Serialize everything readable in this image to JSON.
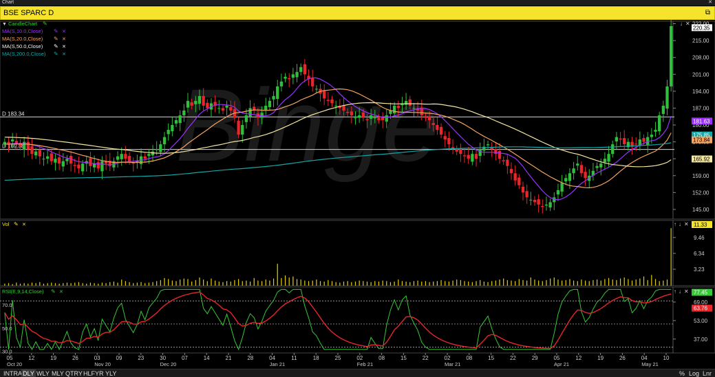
{
  "window": {
    "title": "Chart",
    "close_icon": "close-icon"
  },
  "symbol": {
    "name": "BSE SPARC D",
    "restore_icon": "restore-window-icon"
  },
  "colors": {
    "up": "#2fbf3a",
    "down": "#e8262b",
    "ma10": "#9b30ff",
    "ma20": "#f4a460",
    "ma50": "#f5e6a0",
    "ma200": "#14a8a8",
    "rsi": "#35c935",
    "rsi_signal": "#e8262b",
    "volume": "#e6d100",
    "yellow_bar": "#f5e32c"
  },
  "panels": {
    "price": {
      "legend": [
        {
          "label": "CandleChart",
          "color": "#35c935"
        },
        {
          "label": "MA(S,10.0,Close)",
          "color": "#9b30ff"
        },
        {
          "label": "MA(S,20.0,Close)",
          "color": "#f4a460"
        },
        {
          "label": "MA(S,50.0,Close)",
          "color": "#f5f5f5"
        },
        {
          "label": "MA(S,200.0,Close)",
          "color": "#14a8a8"
        }
      ],
      "hlines": [
        {
          "label": "D 183.34",
          "value": 183.34
        },
        {
          "label": "D 169.88",
          "value": 169.88
        }
      ],
      "ticks": [
        "222.00",
        "215.00",
        "208.00",
        "201.00",
        "194.00",
        "187.00",
        "180.00",
        "173.00",
        "166.00",
        "159.00",
        "152.00",
        "145.00"
      ],
      "last_tags": [
        {
          "label": "220.35",
          "value": 220.35,
          "bg": "#f5f5f5",
          "fg": "#000"
        },
        {
          "label": "181.63",
          "value": 181.63,
          "bg": "#9b30ff",
          "fg": "#fff"
        },
        {
          "label": "175.85",
          "value": 175.85,
          "bg": "#14a8a8",
          "fg": "#fff"
        },
        {
          "label": "173.84",
          "value": 173.84,
          "bg": "#f4a460",
          "fg": "#000"
        },
        {
          "label": "165.92",
          "value": 165.92,
          "bg": "#f5e6a0",
          "fg": "#000"
        }
      ]
    },
    "volume": {
      "legend": "Vol",
      "ticks": [
        "9.46",
        "6.34",
        "3.23"
      ],
      "last_tag": "11.33"
    },
    "rsi": {
      "legend": "RSI(E,9,14,Close)",
      "ticks": [
        "69.00",
        "53.00",
        "37.00"
      ],
      "left_labels": [
        "70.0",
        "50.0",
        "30.0"
      ],
      "tags": [
        {
          "label": "77.45",
          "value": 77.45,
          "bg": "#35c935"
        },
        {
          "label": "63.76",
          "value": 63.76,
          "bg": "#e8262b"
        }
      ]
    }
  },
  "xaxis": {
    "labels": [
      {
        "day": "05",
        "month": "Oct 20"
      },
      {
        "day": "12",
        "month": ""
      },
      {
        "day": "19",
        "month": ""
      },
      {
        "day": "26",
        "month": ""
      },
      {
        "day": "03",
        "month": "Nov 20"
      },
      {
        "day": "09",
        "month": ""
      },
      {
        "day": "23",
        "month": ""
      },
      {
        "day": "30",
        "month": "Dec 20"
      },
      {
        "day": "07",
        "month": ""
      },
      {
        "day": "14",
        "month": ""
      },
      {
        "day": "21",
        "month": ""
      },
      {
        "day": "28",
        "month": ""
      },
      {
        "day": "04",
        "month": "Jan 21"
      },
      {
        "day": "11",
        "month": ""
      },
      {
        "day": "18",
        "month": ""
      },
      {
        "day": "25",
        "month": ""
      },
      {
        "day": "02",
        "month": "Feb 21"
      },
      {
        "day": "08",
        "month": ""
      },
      {
        "day": "15",
        "month": ""
      },
      {
        "day": "22",
        "month": ""
      },
      {
        "day": "02",
        "month": "Mar 21"
      },
      {
        "day": "08",
        "month": ""
      },
      {
        "day": "15",
        "month": ""
      },
      {
        "day": "22",
        "month": ""
      },
      {
        "day": "29",
        "month": ""
      },
      {
        "day": "05",
        "month": "Apr 21"
      },
      {
        "day": "12",
        "month": ""
      },
      {
        "day": "19",
        "month": ""
      },
      {
        "day": "26",
        "month": ""
      },
      {
        "day": "04",
        "month": "May 21"
      },
      {
        "day": "10",
        "month": ""
      }
    ]
  },
  "bottom_tabs": [
    "INTRA",
    "DLY",
    "WLY",
    "MLY",
    "QTRY",
    "HLFYR",
    "YLY"
  ],
  "active_tab": "DLY",
  "bottom_right": [
    "%",
    "Log",
    "Lnr"
  ],
  "chart_data": {
    "type": "candlestick",
    "title": "BSE SPARC D",
    "ylim": [
      141,
      223
    ],
    "volume_ylim": [
      0,
      12
    ],
    "rsi_ylim": [
      25,
      82
    ],
    "closes": [
      173,
      172,
      174,
      172,
      171,
      173,
      170,
      168,
      169,
      167,
      166,
      167,
      165,
      166,
      164,
      165,
      166,
      164,
      163,
      162,
      164,
      165,
      163,
      164,
      162,
      165,
      164,
      163,
      165,
      167,
      168,
      166,
      165,
      164,
      165,
      167,
      166,
      168,
      169,
      170,
      172,
      175,
      178,
      180,
      182,
      184,
      186,
      190,
      188,
      190,
      192,
      188,
      187,
      189,
      188,
      187,
      186,
      188,
      186,
      183,
      176,
      180,
      184,
      187,
      186,
      183,
      185,
      188,
      190,
      192,
      196,
      198,
      200,
      199,
      201,
      202,
      204,
      201,
      199,
      196,
      195,
      193,
      191,
      190,
      189,
      188,
      187,
      186,
      185,
      184,
      183,
      184,
      183,
      182,
      184,
      183,
      182,
      182,
      184,
      186,
      188,
      187,
      189,
      190,
      188,
      187,
      186,
      184,
      183,
      182,
      180,
      178,
      176,
      174,
      172,
      170,
      169,
      168,
      167,
      166,
      168,
      166,
      170,
      171,
      172,
      170,
      168,
      166,
      165,
      163,
      160,
      157,
      155,
      152,
      150,
      149,
      148,
      147,
      146,
      147,
      148,
      150,
      153,
      156,
      158,
      160,
      162,
      164,
      160,
      158,
      159,
      161,
      163,
      164,
      166,
      168,
      172,
      175,
      174,
      172,
      173,
      171,
      172,
      174,
      173,
      175,
      176,
      178,
      184,
      188,
      196,
      221
    ],
    "volume": [
      0.4,
      0.5,
      0.3,
      0.6,
      0.4,
      0.5,
      0.4,
      0.6,
      0.5,
      0.7,
      0.4,
      0.5,
      0.6,
      0.5,
      0.4,
      0.5,
      0.6,
      0.5,
      0.6,
      0.7,
      0.5,
      0.4,
      0.6,
      0.5,
      0.4,
      0.6,
      0.5,
      0.7,
      0.8,
      0.6,
      1.2,
      0.9,
      0.7,
      0.5,
      0.6,
      0.7,
      0.5,
      0.6,
      0.7,
      0.9,
      1.1,
      1.5,
      1.3,
      1.0,
      0.9,
      1.2,
      1.4,
      1.3,
      0.8,
      1.1,
      1.6,
      1.2,
      0.9,
      1.4,
      1.0,
      0.8,
      0.7,
      0.9,
      0.8,
      1.1,
      1.3,
      0.9,
      1.0,
      0.8,
      1.5,
      1.0,
      0.9,
      1.2,
      1.0,
      1.4,
      4.3,
      1.5,
      2.0,
      1.6,
      1.8,
      1.3,
      1.2,
      1.0,
      0.9,
      1.0,
      1.2,
      0.9,
      0.8,
      1.1,
      0.9,
      0.7,
      0.6,
      0.8,
      0.9,
      0.7,
      0.8,
      1.0,
      0.9,
      0.8,
      0.7,
      0.9,
      0.8,
      1.0,
      0.9,
      0.7,
      0.8,
      1.2,
      0.9,
      0.8,
      0.7,
      0.9,
      1.0,
      0.8,
      0.9,
      0.7,
      0.8,
      0.9,
      1.1,
      0.9,
      0.8,
      1.0,
      1.2,
      1.1,
      0.9,
      0.8,
      0.7,
      0.9,
      1.1,
      0.8,
      0.7,
      0.9,
      1.0,
      1.2,
      1.4,
      1.1,
      1.0,
      0.9,
      1.3,
      1.1,
      1.0,
      1.6,
      1.2,
      1.0,
      0.9,
      1.1,
      1.4,
      1.6,
      1.2,
      1.0,
      1.1,
      1.3,
      1.0,
      0.9,
      1.2,
      1.0,
      0.9,
      1.1,
      1.2,
      1.0,
      1.3,
      1.5,
      1.2,
      1.1,
      1.4,
      1.6,
      1.3,
      1.0,
      1.2,
      1.4,
      1.8,
      1.1,
      2.1,
      1.3,
      0.9,
      1.0,
      1.2,
      11.3
    ]
  }
}
